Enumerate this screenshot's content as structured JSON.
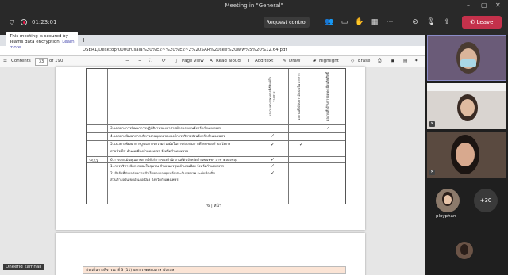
{
  "window": {
    "title": "Meeting in \"General\""
  },
  "meeting": {
    "timer": "01:23:01",
    "remote_control_label": "Request control",
    "leave_label": "Leave"
  },
  "tooltip": {
    "text": "This meeting is secured by Teams data encryption.",
    "link": "Learn more"
  },
  "browser": {
    "url": "USER1/Desktop/0000rusala%20%E2~%20%E2~2%20SAR%20see%20w.w%5%20%12.64.pdf"
  },
  "pdf_toolbar": {
    "contents": "Contents",
    "page_current": "33",
    "page_total": "of 190",
    "minus": "−",
    "plus": "+",
    "page_view": "Page view",
    "read_aloud": "Read aloud",
    "add_text": "Add text",
    "draw": "Draw",
    "highlight": "Highlight",
    "erase": "Erase"
  },
  "document": {
    "year": "2563",
    "rows": [
      "3.แนวทางการพัฒนาการปฏิบัติงานของอาสาสมัครแรงงานจังหวัดกำแพงเพชร",
      "4.แนวทางพัฒนาการบริหารงานบุคคลขององค์การบริหารส่วนจังหวัดกำแพงเพชร",
      "5.แนวทางพัฒนาการบูรณาการความร่วมมือในการส่งเสริมการศึกษาของตำบลวังยาง",
      "สายบัวเพ็ช อำเภอเมืองกำแพงเพชร จังหวัดกำแพงเพชร",
      "6.การประเมินคุณภาพการให้บริการของสำนักงานที่ดินจังหวัดกำแพงเพชร สาขาคลองขลุง",
      "1. การบริหารจัดการขยะในชุมชน ตำบลนครชุม อำเภอเมือง จังหวัดกำแพงเพชร",
      "2. ปัจจัยที่ส่งผลต่อความสำเร็จของกองทุนหลักประกันสุขภาพ ระดับท้องถิ่น",
      "ส่วนตำบลในเขตอำเภอเมือง จังหวัดกำแพงเพชร"
    ],
    "headers": [
      "ผลงานทางวิชาการที่ตีพิมพ์ในวารสาร",
      "ผลงานที่ได้รับการอ้างอิงในวารสาร",
      "ผลงานที่ได้รับการจดทะเบียนลิขสิทธิ์"
    ],
    "page_number": "76 | หน้า",
    "next_heading": "ประเด็นการพิจารณาที่ 3 (11) ผลการทดสอบภาษาอังกฤษ"
  },
  "presenter_name": "Dheerid kamnail",
  "participants": {
    "avatar_name": "ployphan",
    "more_count": "+30"
  },
  "colors": {
    "leave": "#c4314b",
    "accent": "#4f52b2"
  }
}
